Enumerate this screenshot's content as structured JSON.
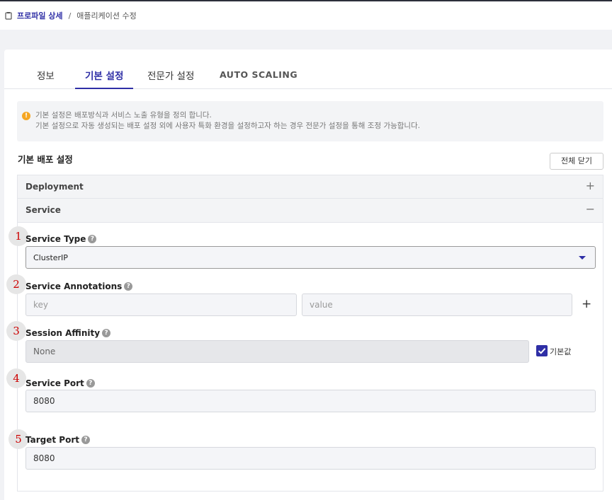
{
  "breadcrumb": {
    "parent": "프로파일 상세",
    "separator": "/",
    "current": "애플리케이션 수정"
  },
  "tabs": [
    {
      "label": "정보"
    },
    {
      "label": "기본 설정"
    },
    {
      "label": "전문가 설정"
    },
    {
      "label": "AUTO SCALING"
    }
  ],
  "notice": {
    "line1": "기본 설정은 배포방식과 서비스 노출 유형을 정의 합니다.",
    "line2": "기본 설정으로 자동 생성되는 배포 설정 외에 사용자 특화 환경을 설정하고자 하는 경우 전문가 설정을 통해 조정 가능합니다."
  },
  "section": {
    "title": "기본 배포 설정",
    "collapse_all": "전체 닫기"
  },
  "accordions": [
    {
      "label": "Deployment",
      "toggle": "+"
    },
    {
      "label": "Service",
      "toggle": "−"
    }
  ],
  "markers": [
    "1",
    "2",
    "3",
    "4",
    "5"
  ],
  "fields": {
    "service_type": {
      "label": "Service Type",
      "value": "ClusterIP"
    },
    "annotations": {
      "label": "Service Annotations",
      "key_placeholder": "key",
      "value_placeholder": "value",
      "add": "+"
    },
    "session_affinity": {
      "label": "Session Affinity",
      "value": "None",
      "default_label": "기본값",
      "default_checked": true
    },
    "service_port": {
      "label": "Service Port",
      "value": "8080"
    },
    "target_port": {
      "label": "Target Port",
      "value": "8080"
    }
  },
  "icons": {
    "help": "?",
    "warning": "!"
  },
  "colors": {
    "accent": "#2f2fa6",
    "warning": "#f5a623",
    "marker_text": "#cc0000"
  }
}
